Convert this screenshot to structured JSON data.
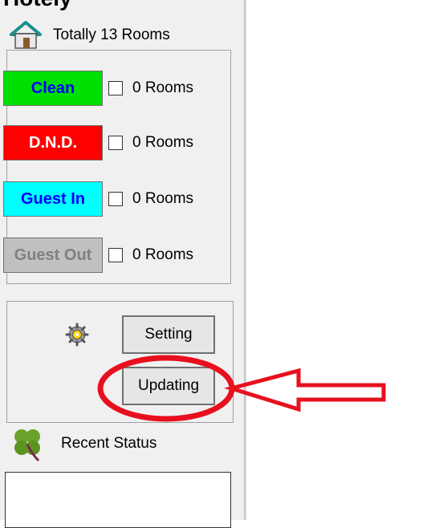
{
  "page_title": "Hotely",
  "header": {
    "total_text": "Totally 13 Rooms"
  },
  "statuses": [
    {
      "label": "Clean",
      "count_text": "0 Rooms",
      "bg": "#00e000",
      "fg": "#0000ff"
    },
    {
      "label": "D.N.D.",
      "count_text": "0 Rooms",
      "bg": "#ff0000",
      "fg": "#ffffff"
    },
    {
      "label": "Guest In",
      "count_text": "0 Rooms",
      "bg": "#00ffff",
      "fg": "#0000ff"
    },
    {
      "label": "Guest Out",
      "count_text": "0 Rooms",
      "bg": "#c0c0c0",
      "fg": "#808080"
    }
  ],
  "buttons": {
    "setting": "Setting",
    "updating": "Updating"
  },
  "recent": {
    "label": "Recent Status"
  },
  "icons": {
    "home": "home-icon",
    "gear": "gear-icon",
    "clover": "clover-icon"
  },
  "annotation": {
    "color": "#e8101e"
  }
}
